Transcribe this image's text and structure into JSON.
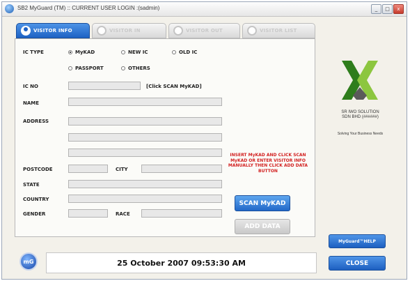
{
  "window": {
    "title": "SB2 MyGuard (TM) :: CURRENT USER LOGIN :(sadmin)",
    "controls": [
      "_",
      "□",
      "x"
    ]
  },
  "tabs": [
    {
      "label": "VISITOR INFO",
      "active": true,
      "icon": "person-icon"
    },
    {
      "label": "VISITOR IN",
      "active": false,
      "icon": "arrow-icon"
    },
    {
      "label": "VISITOR OUT",
      "active": false,
      "icon": "arrow-icon"
    },
    {
      "label": "VISITOR LIST",
      "active": false,
      "icon": "person-icon"
    }
  ],
  "form": {
    "ic_type_label": "IC TYPE",
    "ic_types": [
      {
        "label": "MyKAD",
        "selected": true
      },
      {
        "label": "NEW IC",
        "selected": false
      },
      {
        "label": "OLD IC",
        "selected": false
      },
      {
        "label": "PASSPORT",
        "selected": false
      },
      {
        "label": "OTHERS",
        "selected": false
      }
    ],
    "ic_no_label": "IC NO",
    "ic_no_value": "",
    "scan_hint": "[Click SCAN MyKAD]",
    "name_label": "NAME",
    "name_value": "",
    "address_label": "ADDRESS",
    "address_lines": [
      "",
      "",
      ""
    ],
    "postcode_label": "POSTCODE",
    "postcode_value": "",
    "city_label": "CITY",
    "city_value": "",
    "state_label": "STATE",
    "state_value": "",
    "country_label": "COUNTRY",
    "country_value": "",
    "gender_label": "GENDER",
    "gender_value": "",
    "race_label": "RACE",
    "race_value": ""
  },
  "instruction": "INSERT MyKAD AND CLICK SCAN MyKAD OR ENTER VISITOR INFO MANUALLY THEN CLICK ADD DATA BUTTON",
  "buttons": {
    "scan": "SCAN MyKAD",
    "add": "ADD DATA",
    "help": "MyGuard™HELP",
    "close": "CLOSE"
  },
  "company": {
    "name_line1": "SR IWO SOLUTION",
    "name_line2": "SDN BHD (######)",
    "tagline": "Solving Your Business Needs"
  },
  "footer": {
    "logo_text": "mG",
    "datetime": "25 October 2007 09:53:30 AM"
  },
  "colors": {
    "accent_blue": "#1d62c4",
    "instruction_red": "#d21f1f",
    "logo_green_dark": "#2e7d1c",
    "logo_green_light": "#8cc63f"
  }
}
